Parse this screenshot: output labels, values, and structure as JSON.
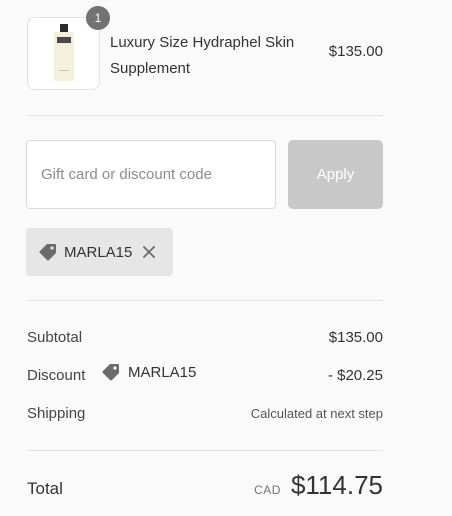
{
  "product": {
    "quantity": "1",
    "name": "Luxury Size Hydraphel Skin Supplement",
    "price": "$135.00"
  },
  "discount_form": {
    "placeholder": "Gift card or discount code",
    "apply_label": "Apply"
  },
  "applied_code": {
    "code": "MARLA15"
  },
  "summary": {
    "subtotal_label": "Subtotal",
    "subtotal_value": "$135.00",
    "discount_label": "Discount",
    "discount_code": "MARLA15",
    "discount_value": "- $20.25",
    "shipping_label": "Shipping",
    "shipping_value": "Calculated at next step"
  },
  "total": {
    "label": "Total",
    "currency": "CAD",
    "amount": "$114.75"
  },
  "icons": {
    "tag": "tag-icon",
    "remove": "close-icon"
  },
  "colors": {
    "apply_disabled": "#c8c8c8",
    "badge": "#727272",
    "chip_bg": "#e6e6e6"
  }
}
